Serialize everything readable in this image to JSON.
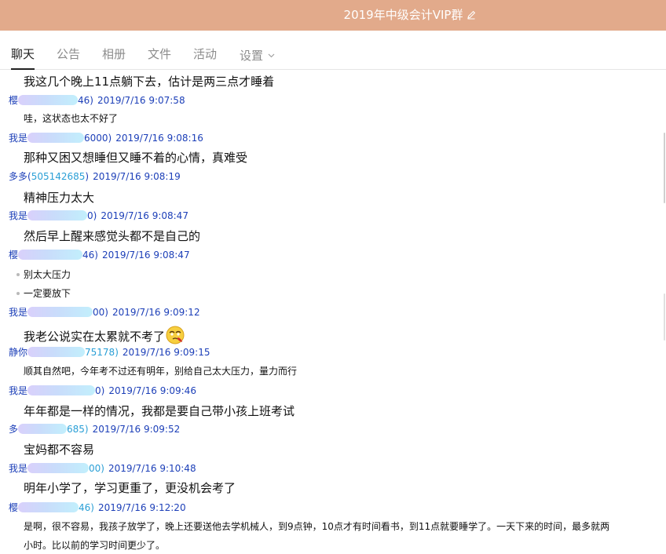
{
  "header": {
    "title": "2019年中级会计VIP群",
    "edit_icon": "pencil-icon"
  },
  "tabs": [
    {
      "label": "聊天",
      "active": true
    },
    {
      "label": "公告"
    },
    {
      "label": "相册"
    },
    {
      "label": "文件"
    },
    {
      "label": "活动"
    },
    {
      "label": "设置",
      "dropdown": true
    }
  ],
  "messages": {
    "m0": {
      "text": "我这几个晚上11点躺下去，估计是两三点才睡着"
    },
    "s1": {
      "name": "樱",
      "qq_tail": "46)",
      "time": "2019/7/16 9:07:58"
    },
    "m1": {
      "text": "哇，这状态也太不好了"
    },
    "s2": {
      "name": "我是",
      "qq_tail": "6000)",
      "time": "2019/7/16 9:08:16"
    },
    "m2": {
      "text": "那种又困又想睡但又睡不着的心情，真难受"
    },
    "s3": {
      "name": "多多(",
      "qq": "505142685",
      "close": ")",
      "time": "2019/7/16 9:08:19"
    },
    "m3": {
      "text": "精神压力太大"
    },
    "s4": {
      "name": "我是",
      "qq_tail": "0)",
      "time": "2019/7/16 9:08:47"
    },
    "m4": {
      "text": "然后早上醒来感觉头都不是自己的"
    },
    "s5": {
      "name": "樱",
      "qq_tail": "46)",
      "time": "2019/7/16 9:08:47"
    },
    "m5a": {
      "text": "别太大压力"
    },
    "m5b": {
      "text": "一定要放下"
    },
    "s6": {
      "name": "我是",
      "qq_tail": "00)",
      "time": "2019/7/16 9:09:12"
    },
    "m6": {
      "text": "我老公说实在太累就不考了",
      "emoji": "dizzy-face-emoji"
    },
    "s7": {
      "name": "静你",
      "qq_tail": "75178)",
      "time": "2019/7/16 9:09:15"
    },
    "m7": {
      "text": "顺其自然吧，今年考不过还有明年，别给自己太大压力，量力而行"
    },
    "s8": {
      "name": "我是",
      "qq_tail": "0)",
      "time": "2019/7/16 9:09:46"
    },
    "m8": {
      "text": "年年都是一样的情况，我都是要自己带小孩上班考试"
    },
    "s9": {
      "name": "多",
      "qq_tail": "685)",
      "time": "2019/7/16 9:09:52"
    },
    "m9": {
      "text": "宝妈都不容易"
    },
    "s10": {
      "name": "我是",
      "qq_tail": "00)",
      "time": "2019/7/16 9:10:48"
    },
    "m10": {
      "text": "明年小学了，学习更重了，更没机会考了"
    },
    "s11": {
      "name": "樱",
      "qq_tail": "46)",
      "time": "2019/7/16 9:12:20"
    },
    "m11a": {
      "text": "是啊，很不容易，我孩子放学了，晚上还要送他去学机械人，到9点钟，10点才有时间看书，到11点就要睡学了。一天下来的时间，最多就两"
    },
    "m11b": {
      "text": "小时。比以前的学习时间更少了。"
    }
  },
  "colors": {
    "header_bg": "#e2aa8b",
    "sender_name": "#1c3fb8",
    "qq_link": "#2a9fd6"
  }
}
